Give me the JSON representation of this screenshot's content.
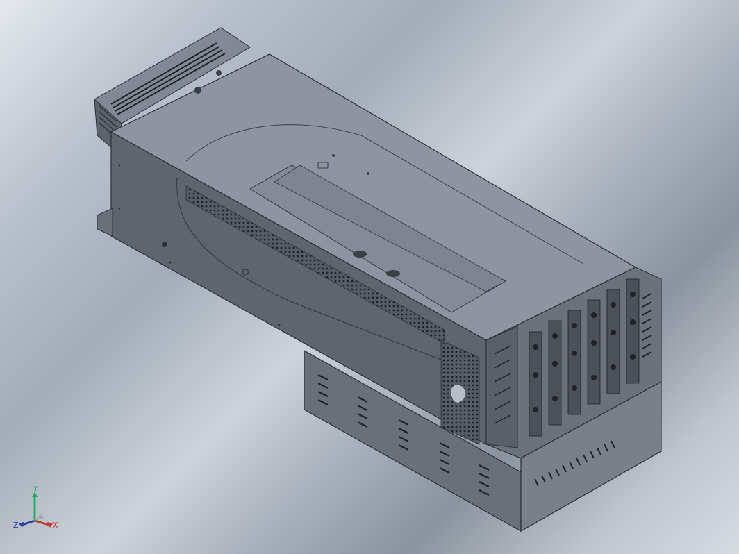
{
  "viewport": {
    "background_top": "#e4e8ee",
    "background_mid": "#a3acb8",
    "background_bottom": "#8b939e"
  },
  "model": {
    "colors": {
      "body_top": "#8f95a0",
      "body_side": "#5d636d",
      "body_front": "#6c727c",
      "edge": "#2b2f36",
      "vent": "#25282e",
      "panel": "#7d838e"
    }
  },
  "triad": {
    "x_label": "X",
    "y_label": "Y",
    "z_label": "Z",
    "x_color": "#c0392b",
    "y_color": "#27ae60",
    "z_color": "#2c3e9e"
  }
}
